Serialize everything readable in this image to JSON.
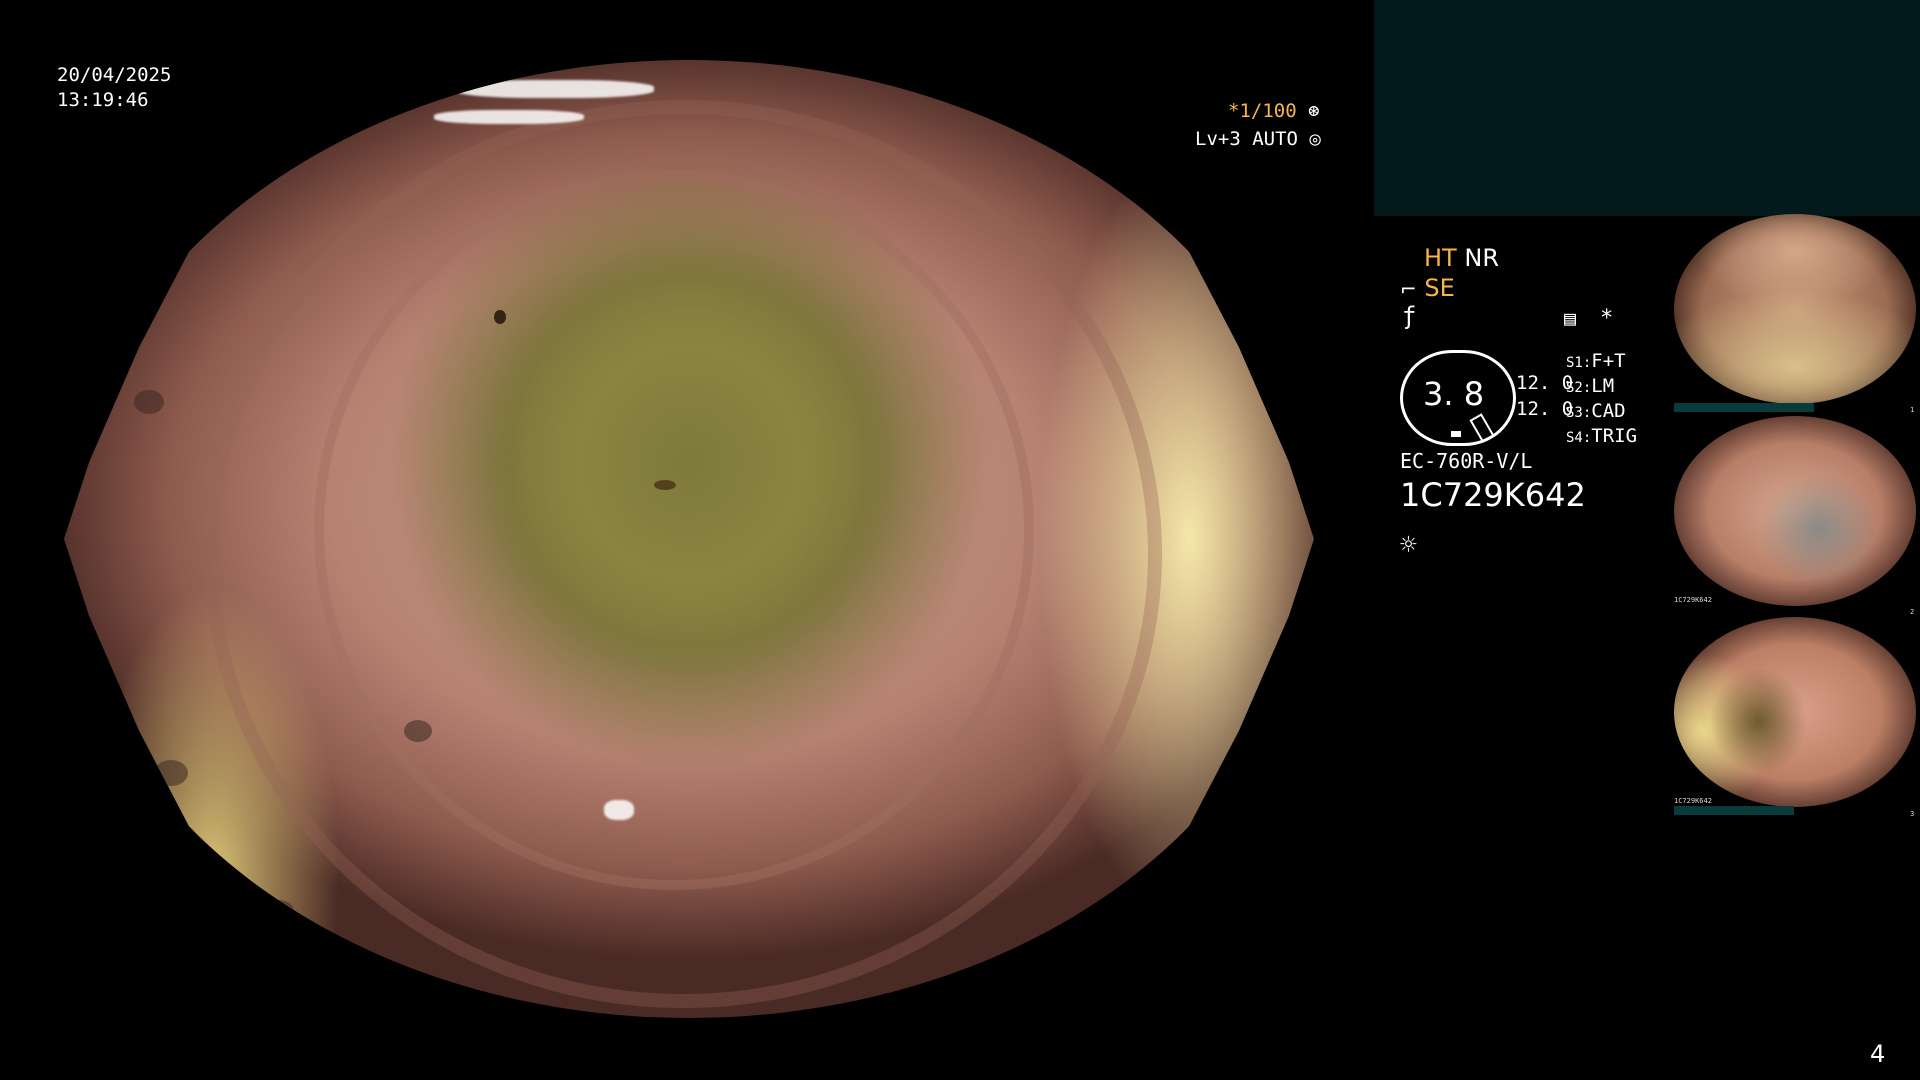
{
  "overlay": {
    "date": "20/04/2025",
    "time": "13:19:46",
    "shutter": "*1/100",
    "level": "Lv+3 AUTO",
    "page_number": "4"
  },
  "panel": {
    "mode_primary": "HT",
    "mode_secondary": "NR",
    "enhance_label": "SE",
    "asterisk": "*",
    "meter_value": "3. 8",
    "meter_readings": [
      "12. 0",
      "12. 0"
    ],
    "scope_keys": [
      {
        "key": "S1:",
        "value": "F+T"
      },
      {
        "key": "S2:",
        "value": "LM"
      },
      {
        "key": "S3:",
        "value": "CAD"
      },
      {
        "key": "S4:",
        "value": "TRIG"
      }
    ],
    "scope_model": "EC-760R-V/L",
    "serial_number": "1C729K642"
  },
  "thumbnails": [
    {
      "id": "thumb-1",
      "corner_label": "1"
    },
    {
      "id": "thumb-2",
      "corner_label": "2",
      "footer": "1C729K642"
    },
    {
      "id": "thumb-3",
      "corner_label": "3",
      "footer": "1C729K642"
    }
  ],
  "colors": {
    "accent_orange": "#f7b54a",
    "panel_teal": "#031a1c",
    "thumb_strip": "#0a3b3c"
  }
}
